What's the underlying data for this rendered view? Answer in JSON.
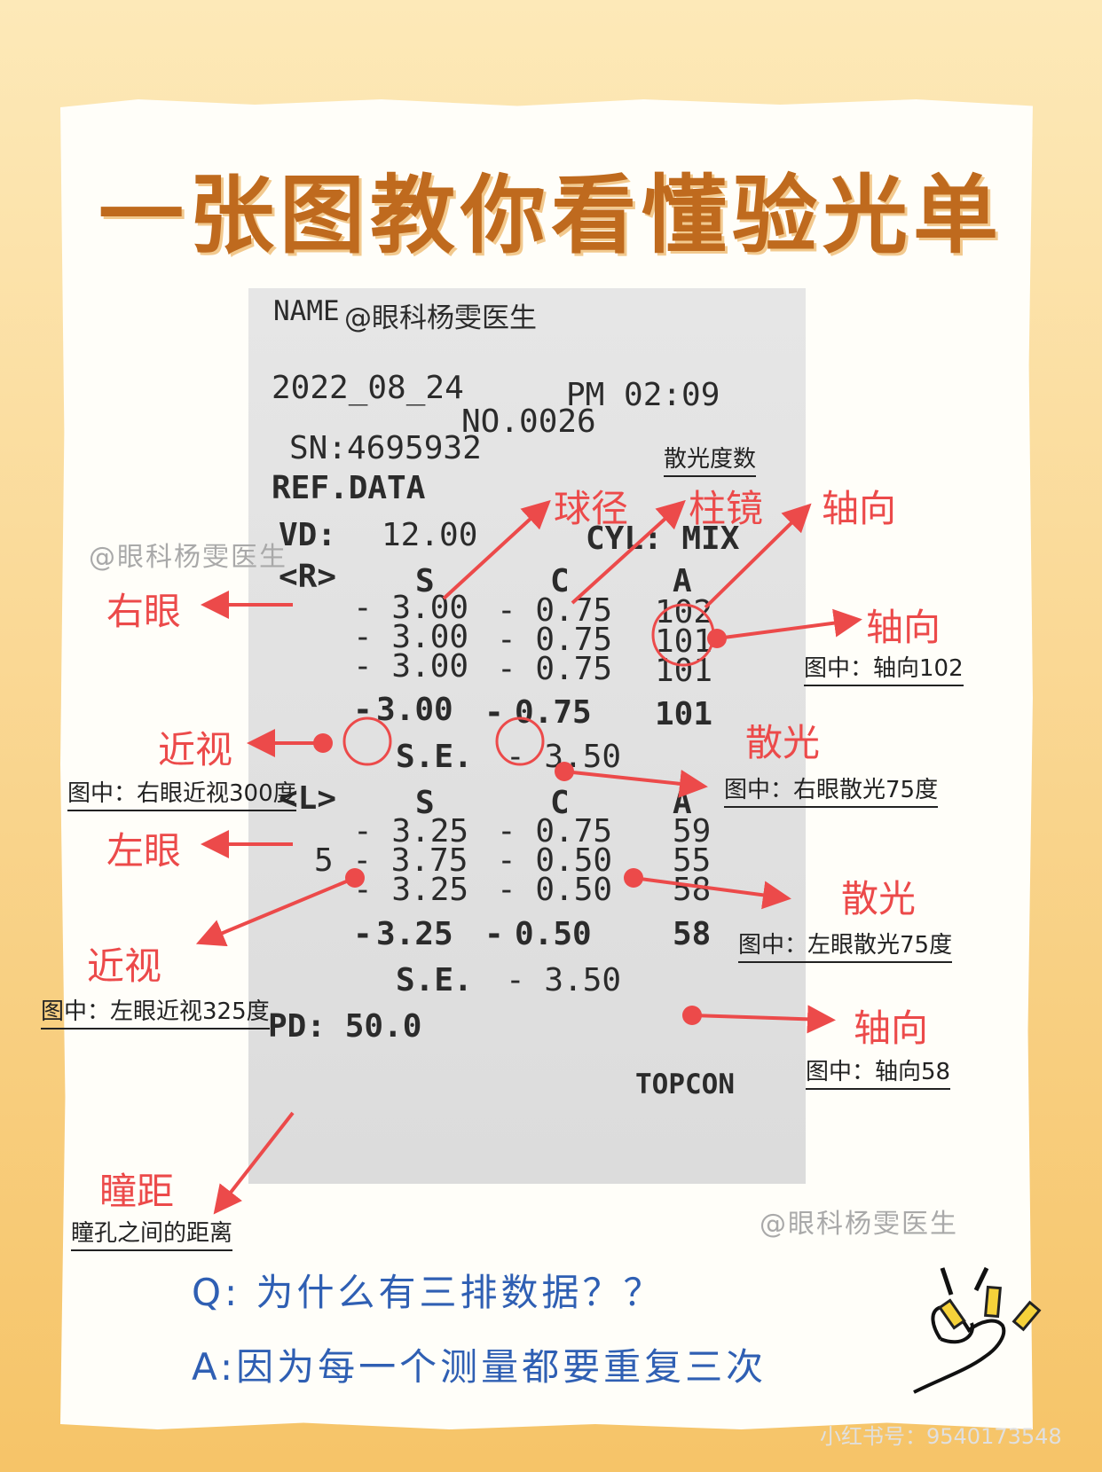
{
  "title": "一张图教你看懂验光单",
  "receipt": {
    "name_label": "NAME",
    "name_value": "@眼科杨雯医生",
    "date": "2022_08_24",
    "time": "PM 02:09",
    "no": "NO.0026",
    "sn": "SN:4695932",
    "ref": "REF.DATA",
    "vd_label": "VD:",
    "vd_value": "12.00",
    "cyl_label": "CYL: MIX",
    "right": {
      "tag": "<R>",
      "headers": [
        "S",
        "C",
        "A"
      ],
      "rows": [
        [
          "- 3.00",
          "- 0.75",
          "102"
        ],
        [
          "- 3.00",
          "- 0.75",
          "101"
        ],
        [
          "- 3.00",
          "- 0.75",
          "101"
        ]
      ],
      "avg": [
        "3.00",
        "0.75",
        "101"
      ],
      "se_label": "S.E.",
      "se_value": "- 3.50"
    },
    "left": {
      "tag": "<L>",
      "headers": [
        "S",
        "C",
        "A"
      ],
      "rows": [
        [
          "- 3.25",
          "- 0.75",
          "59"
        ],
        [
          "5 - 3.75",
          "- 0.50",
          "55"
        ],
        [
          "- 3.25",
          "- 0.50",
          "58"
        ]
      ],
      "avg": [
        "3.25",
        "0.50",
        "58"
      ],
      "se_label": "S.E.",
      "se_value": "- 3.50"
    },
    "pd": "PD: 50.0",
    "brand": "TOPCON"
  },
  "labels": {
    "sph": "球径",
    "cyl": "柱镜",
    "axis_top": "轴向",
    "cyl_degree": "散光度数",
    "right_eye": "右眼",
    "axis_r": "轴向",
    "axis_r_note": "图中：轴向102",
    "myopia_r": "近视",
    "myopia_r_note": "图中：右眼近视300度",
    "astig_r": "散光",
    "astig_r_note": "图中：右眼散光75度",
    "left_eye": "左眼",
    "astig_l": "散光",
    "astig_l_note": "图中：左眼散光75度",
    "myopia_l": "近视",
    "myopia_l_note": "图中：左眼近视325度",
    "axis_l": "轴向",
    "axis_l_note": "图中：轴向58",
    "pd_label": "瞳距",
    "pd_note": "瞳孔之间的距离"
  },
  "watermark": "@眼科杨雯医生",
  "question": "Q: 为什么有三排数据？？",
  "answer": "A:因为每一个测量都要重复三次",
  "footer": "小红书号：9540173548",
  "colors": {
    "annotation": "#ec4a4a",
    "title": "#bf6a1e",
    "qa": "#2f5fb3"
  }
}
